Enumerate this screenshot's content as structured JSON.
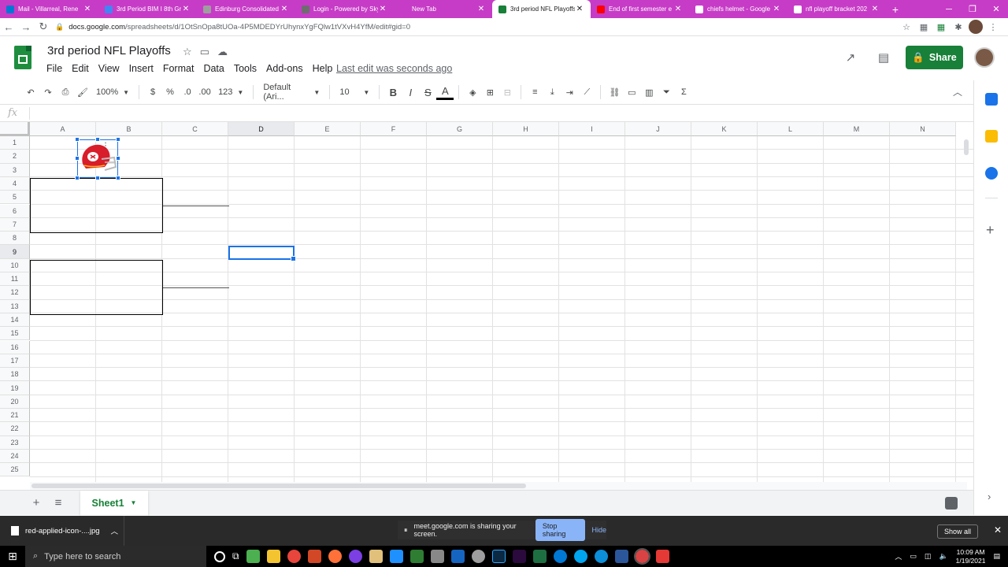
{
  "browser": {
    "tabs": [
      {
        "title": "Mail - Villarreal, Rene",
        "favicon": "#0078d4"
      },
      {
        "title": "3rd Period BIM I 8th Gr",
        "favicon": "#4285f4"
      },
      {
        "title": "Edinburg Consolidated",
        "favicon": "#9e9e9e"
      },
      {
        "title": "Login - Powered by Sky",
        "favicon": "#6d6d6d"
      },
      {
        "title": "New Tab",
        "favicon": ""
      },
      {
        "title": "3rd period NFL Playoffs",
        "favicon": "#188038"
      },
      {
        "title": "End of first semester e",
        "favicon": "#ff0000"
      },
      {
        "title": "chiefs helmet - Google",
        "favicon": "#ffffff"
      },
      {
        "title": "nfl playoff bracket 202",
        "favicon": "#ffffff"
      }
    ],
    "active_tab_index": 5,
    "close_glyph": "✕",
    "new_tab_glyph": "+",
    "window_controls": [
      "─",
      "❐",
      "✕"
    ],
    "nav": {
      "back": "←",
      "forward": "→",
      "reload": "↻"
    },
    "url_host": "docs.google.com",
    "url_path": "/spreadsheets/d/1OtSnOpa8tUOa-4P5MDEDYrUhynxYgFQlw1tVXvH4YfM/edit#gid=0"
  },
  "doc": {
    "title": "3rd period NFL Playoffs",
    "menus": [
      "File",
      "Edit",
      "View",
      "Insert",
      "Format",
      "Data",
      "Tools",
      "Add-ons",
      "Help"
    ],
    "last_edit": "Last edit was seconds ago",
    "share_label": "Share"
  },
  "toolbar": {
    "zoom": "100%",
    "currency": "$",
    "percent": "%",
    "decrease_decimal": ".0",
    "increase_decimal": ".00",
    "more_formats": "123",
    "font": "Default (Ari...",
    "font_size": "10",
    "bold": "B",
    "italic": "I",
    "strike": "S",
    "text_color": "A"
  },
  "formula_bar": {
    "fx": "fx",
    "value": ""
  },
  "sheet": {
    "columns": [
      "A",
      "B",
      "C",
      "D",
      "E",
      "F",
      "G",
      "H",
      "I",
      "J",
      "K",
      "L",
      "M",
      "N"
    ],
    "rows": [
      "1",
      "2",
      "3",
      "4",
      "5",
      "6",
      "7",
      "8",
      "9",
      "10",
      "11",
      "12",
      "13",
      "14",
      "15",
      "16",
      "17",
      "18",
      "19",
      "20",
      "21",
      "22",
      "23",
      "24",
      "25"
    ],
    "selected_cell": "D9",
    "selected_column": "D",
    "selected_row": "9",
    "tab_name": "Sheet1"
  },
  "downloads": {
    "file_name": "red-applied-icon-....jpg",
    "sharing_text": "meet.google.com is sharing your screen.",
    "stop_label": "Stop sharing",
    "hide_label": "Hide",
    "show_all_label": "Show all"
  },
  "taskbar": {
    "search_placeholder": "Type here to search",
    "time": "10:09 AM",
    "date": "1/19/2021"
  },
  "colors": {
    "tabstrip": "#c63cc6",
    "sheets_green": "#188038",
    "selection_blue": "#1a73e8"
  }
}
